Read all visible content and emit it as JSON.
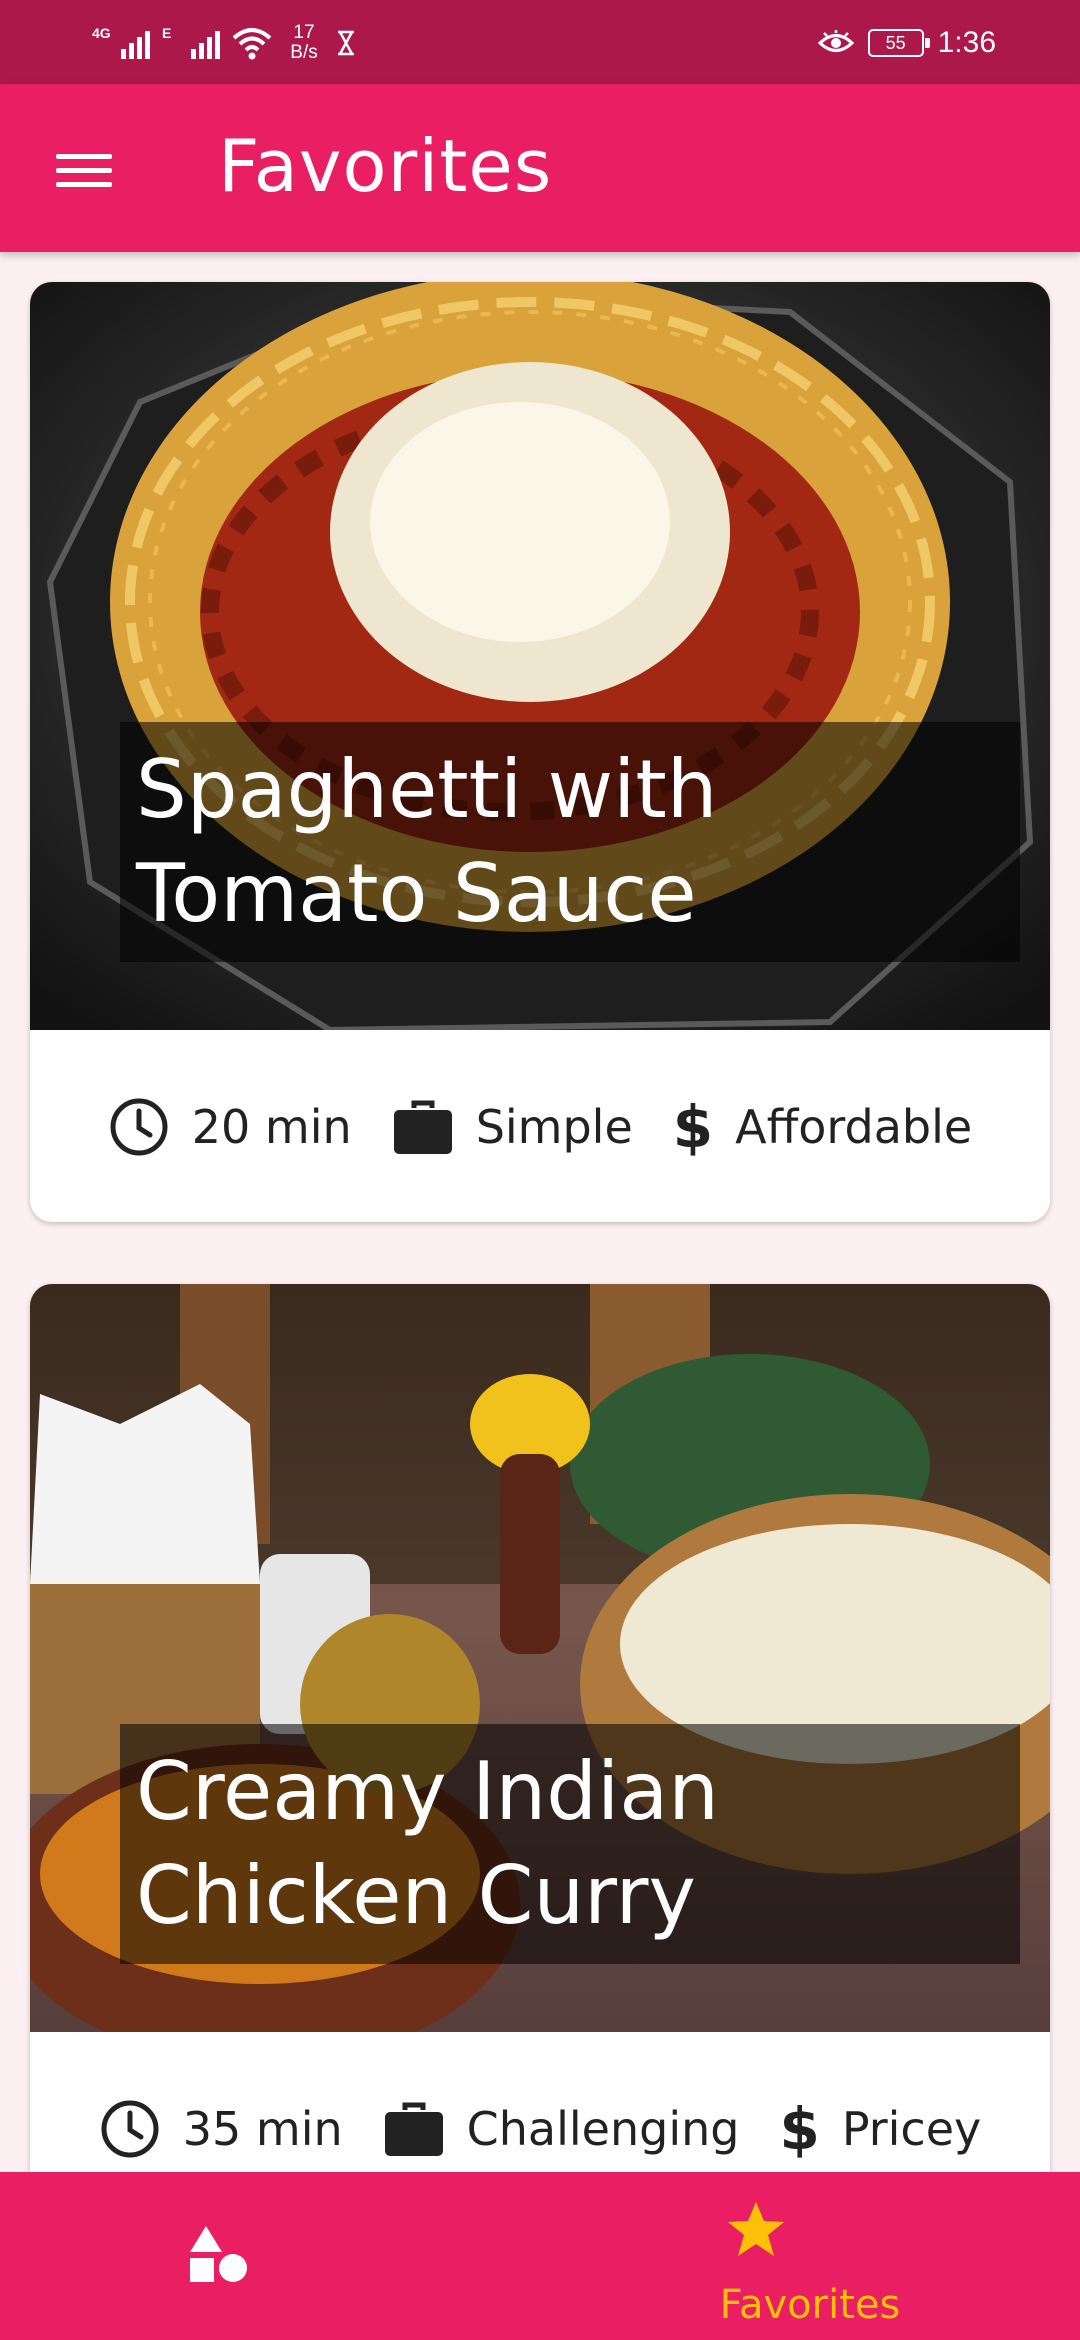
{
  "status_bar": {
    "signal1_tech": "4G",
    "signal2_tech": "E",
    "net_speed_value": "17",
    "net_speed_unit": "B/s",
    "battery": "55",
    "time": "1:36"
  },
  "app_bar": {
    "title": "Favorites",
    "menu_icon": "hamburger-menu-icon"
  },
  "meals": [
    {
      "title_line1": "Spaghetti with",
      "title_line2": "Tomato Sauce",
      "duration": "20 min",
      "complexity": "Simple",
      "affordability": "Affordable"
    },
    {
      "title_line1": "Creamy Indian",
      "title_line2": "Chicken Curry",
      "duration": "35 min",
      "complexity": "Challenging",
      "affordability": "Pricey"
    }
  ],
  "bottom_nav": {
    "categories_icon": "categories-shapes-icon",
    "favorites_label": "Favorites",
    "favorites_icon": "star-icon",
    "active_color": "#ffc107"
  },
  "colors": {
    "primary": "#e91e63",
    "status_bar": "#ad184b",
    "background": "#fdf0f2"
  }
}
